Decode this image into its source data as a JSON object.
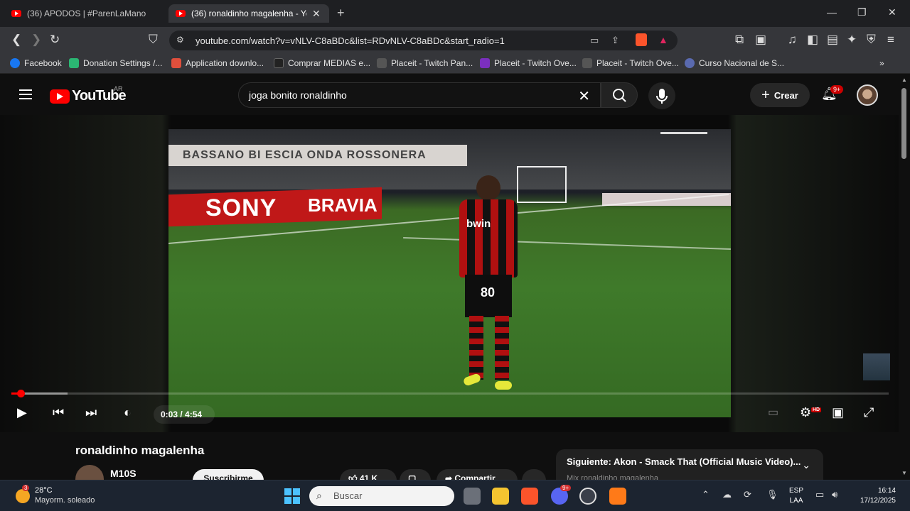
{
  "browser": {
    "tabs": [
      {
        "title": "(36) APODOS | #ParenLaMano - YouT",
        "active": false
      },
      {
        "title": "(36) ronaldinho magalenha - You",
        "active": true
      }
    ],
    "url": "youtube.com/watch?v=vNLV-C8aBDc&list=RDvNLV-C8aBDc&start_radio=1",
    "bookmarks": [
      {
        "label": "Facebook",
        "color": "#1877f2"
      },
      {
        "label": "Donation Settings /...",
        "color": "#2bb673"
      },
      {
        "label": "Application downlo...",
        "color": "#e04f3c"
      },
      {
        "label": "Comprar MEDIAS e...",
        "color": "#222222"
      },
      {
        "label": "Placeit - Twitch Pan...",
        "color": "#555555"
      },
      {
        "label": "Placeit - Twitch Ove...",
        "color": "#7b2fbe"
      },
      {
        "label": "Placeit - Twitch Ove...",
        "color": "#555555"
      },
      {
        "label": "Curso Nacional de S...",
        "color": "#5a6ab0"
      }
    ]
  },
  "youtube": {
    "logo_text": "YouTube",
    "region": "AR",
    "search_value": "joga bonito ronaldinho",
    "create_label": "Crear",
    "notif_count": "9+"
  },
  "player": {
    "time": "0:03 / 4:54",
    "progress_fraction": 0.0102,
    "buffered_fraction": 0.064,
    "video_text": {
      "banner": "BASSANO BI ESCIA  ONDA ROSSONERA",
      "ad1": "SONY",
      "ad2": "BRAVIA",
      "shirt": "bwin",
      "number": "80"
    },
    "hd_badge": "HD"
  },
  "video": {
    "title": "ronaldinho magalenha",
    "channel": "M10S",
    "subscribe_label": "Suscribirme",
    "likes": "41 K",
    "share_label": "Compartir"
  },
  "up_next": {
    "label": "Siguiente: Akon - Smack That (Official Music Video)...",
    "sub": "Mix ronaldinho magalenha"
  },
  "taskbar": {
    "weather_badge": "3",
    "temperature": "28°C",
    "condition": "Mayorm. soleado",
    "search_placeholder": "Buscar",
    "discord_badge": "9+",
    "lang": "ESP",
    "lang2": "LAA",
    "time": "16:14",
    "date": "17/12/2025"
  }
}
